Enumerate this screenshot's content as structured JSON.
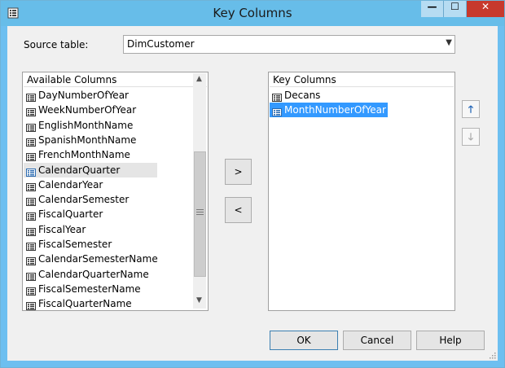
{
  "window": {
    "title": "Key Columns"
  },
  "titlebar_buttons": {
    "min": "—",
    "max": "☐",
    "close": "✕"
  },
  "source": {
    "label": "Source table:",
    "value": "DimCustomer"
  },
  "available": {
    "header": "Available Columns",
    "items": [
      "DayNumberOfYear",
      "WeekNumberOfYear",
      "EnglishMonthName",
      "SpanishMonthName",
      "FrenchMonthName",
      "CalendarQuarter",
      "CalendarYear",
      "CalendarSemester",
      "FiscalQuarter",
      "FiscalYear",
      "FiscalSemester",
      "CalendarSemesterName",
      "CalendarQuarterName",
      "FiscalSemesterName",
      "FiscalQuarterName"
    ],
    "hovered_index": 5
  },
  "key": {
    "header": "Key Columns",
    "items": [
      "Decans",
      "MonthNumberOfYear"
    ],
    "selected_index": 1
  },
  "transfer": {
    "add": ">",
    "remove": "<"
  },
  "order": {
    "up": "🡑",
    "down": "🡓"
  },
  "buttons": {
    "ok": "OK",
    "cancel": "Cancel",
    "help": "Help"
  },
  "colors": {
    "selection": "#3399ff",
    "hover": "#e5e5e5",
    "titlebar": "#67bde9"
  }
}
